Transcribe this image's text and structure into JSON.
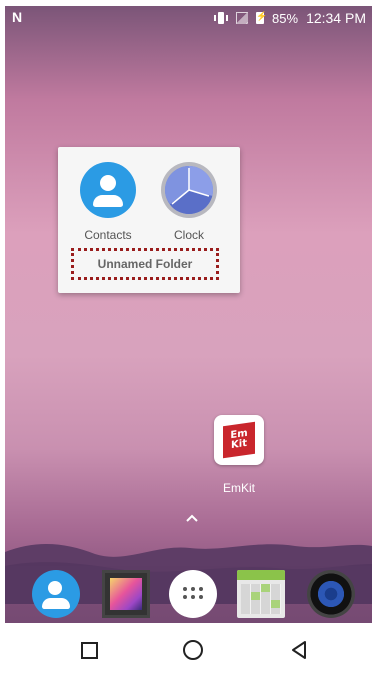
{
  "status_bar": {
    "notification_icon": "N",
    "battery_percent": "85%",
    "time": "12:34 PM",
    "icons": [
      "vibrate-icon",
      "no-signal-icon",
      "battery-charging-icon"
    ]
  },
  "folder": {
    "name": "Unnamed Folder",
    "apps": [
      {
        "label": "Contacts",
        "icon": "contacts-icon"
      },
      {
        "label": "Clock",
        "icon": "clock-icon"
      }
    ]
  },
  "home_apps": [
    {
      "label": "EmKit",
      "icon": "emkit-icon",
      "icon_text": "Em Kit"
    }
  ],
  "app_drawer_handle": "chevron-up-icon",
  "dock": [
    "contacts-icon",
    "gallery-icon",
    "app-drawer-icon",
    "calendar-icon",
    "music-icon"
  ],
  "nav": [
    "recents-button",
    "home-button",
    "back-button"
  ],
  "colors": {
    "folder_name_highlight": "#9a1d1d",
    "contacts_blue": "#2b9be4",
    "emkit_red": "#c9262c"
  }
}
